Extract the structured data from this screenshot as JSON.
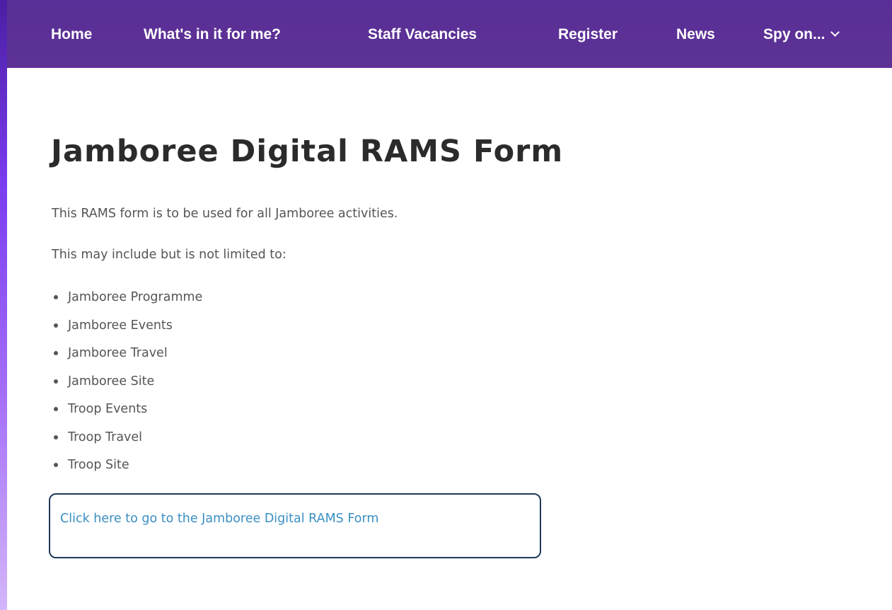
{
  "nav": {
    "items": [
      {
        "label": "Home"
      },
      {
        "label": "What's in it for me?"
      },
      {
        "label": "Staff Vacancies"
      },
      {
        "label": "Register"
      },
      {
        "label": "News"
      },
      {
        "label": "Spy on..."
      }
    ],
    "dropdown_icon": "chevron-down-icon"
  },
  "content": {
    "title": "Jamboree Digital RAMS Form",
    "intro": "This RAMS form is to be used for all Jamboree activities.",
    "lead": "This may include but is not limited to:",
    "items": [
      "Jamboree Programme",
      "Jamboree Events",
      "Jamboree Travel",
      "Jamboree Site",
      "Troop Events",
      "Troop Travel",
      "Troop Site"
    ],
    "link_text": "Click here to go to the Jamboree Digital RAMS Form"
  },
  "colors": {
    "nav_background": "#5a2f97",
    "link": "#3a8fc4",
    "highlight_border": "#1f3a5a"
  }
}
